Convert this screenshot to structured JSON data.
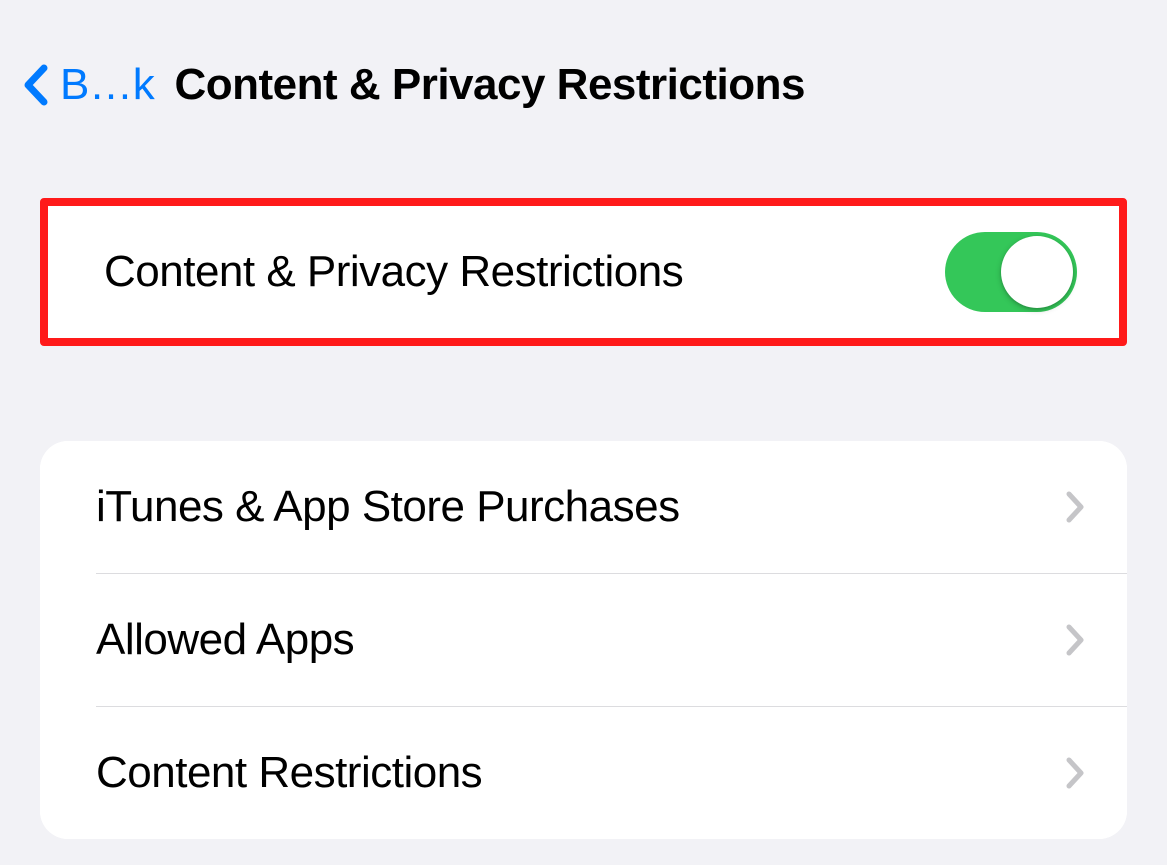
{
  "header": {
    "back_label": "B…k",
    "title": "Content & Privacy Restrictions"
  },
  "toggle_section": {
    "label": "Content & Privacy Restrictions",
    "enabled": true,
    "highlighted": true
  },
  "menu_section": {
    "items": [
      {
        "label": "iTunes & App Store Purchases"
      },
      {
        "label": "Allowed Apps"
      },
      {
        "label": "Content Restrictions"
      }
    ]
  },
  "colors": {
    "accent": "#007aff",
    "toggle_on": "#34c759",
    "highlight_border": "#ff1a1a",
    "background": "#f2f2f6",
    "cell_bg": "#ffffff",
    "chevron": "#c5c5c8"
  }
}
